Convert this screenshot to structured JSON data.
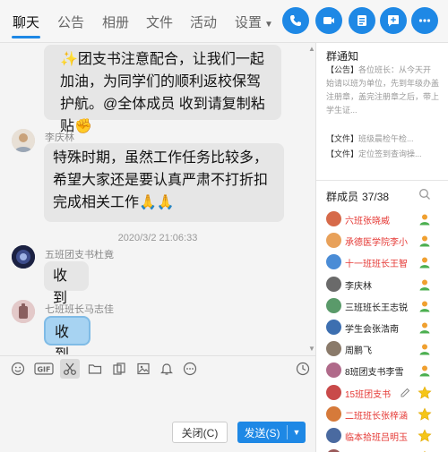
{
  "tabs": [
    {
      "label": "聊天"
    },
    {
      "label": "公告"
    },
    {
      "label": "相册"
    },
    {
      "label": "文件"
    },
    {
      "label": "活动"
    },
    {
      "label": "设置"
    }
  ],
  "header_icons": [
    "phone-icon",
    "video-call-icon",
    "course-icon",
    "add-chat-icon",
    "more-icon"
  ],
  "accent_color": "#1e88e5",
  "messages": [
    {
      "text": "✨团支书注意配合，让我们一起加油，为同学们的顺利返校保驾护航。@全体成员 收到请复制粘贴✊"
    },
    {
      "sender": "李庆林",
      "text": "特殊时期，虽然工作任务比较多，希望大家还是要认真严肃不打折扣完成相关工作🙏🙏"
    },
    {
      "time": "2020/3/2 21:06:33"
    },
    {
      "sender": "五班团支书杜竟",
      "text": "收到"
    },
    {
      "sender": "七班班长马志佳",
      "text": "收到"
    }
  ],
  "toolbar_icons": [
    "emoji-icon",
    "gif-icon",
    "scissors-icon",
    "folder-icon",
    "screenshot-icon",
    "image-icon",
    "bell-icon",
    "more-circle-icon",
    "history-icon"
  ],
  "buttons": {
    "close": "关闭(C)",
    "send": "发送(S)"
  },
  "notice": {
    "title": "群通知",
    "tag": "【公告】",
    "body": "各位班长：从今天开始请以班为单位，先到年级办盖注册章，盖完注册章之后，带上学生证...",
    "files": [
      {
        "tag": "【文件】",
        "name": "班级晨检午检..."
      },
      {
        "tag": "【文件】",
        "name": "定位签到查询操..."
      }
    ]
  },
  "members": {
    "title": "群成员",
    "count": "37/38",
    "list": [
      {
        "name": "六班张晓威",
        "red": true,
        "badge": "user-icon"
      },
      {
        "name": "承德医学院李小",
        "red": true,
        "badge": "user-icon"
      },
      {
        "name": "十一班班长王智",
        "red": true,
        "badge": "user-icon"
      },
      {
        "name": "李庆林",
        "red": false,
        "badge": "user-icon"
      },
      {
        "name": "三班班长王志锐",
        "red": false,
        "badge": "user-icon"
      },
      {
        "name": "学生会张浩南",
        "red": false,
        "badge": "user-icon"
      },
      {
        "name": "周鹏飞",
        "red": false,
        "badge": "user-icon"
      },
      {
        "name": "8班团支书李雪",
        "red": false,
        "badge": "user-icon"
      },
      {
        "name": "15班团支书",
        "red": true,
        "badge": "star-icon"
      },
      {
        "name": "二班班长张梓涵",
        "red": true,
        "badge": "star-icon"
      },
      {
        "name": "临本拾班吕明玉",
        "red": true,
        "badge": "star-icon"
      },
      {
        "name": "一班班班长",
        "red": true,
        "badge": "star-icon"
      }
    ]
  }
}
